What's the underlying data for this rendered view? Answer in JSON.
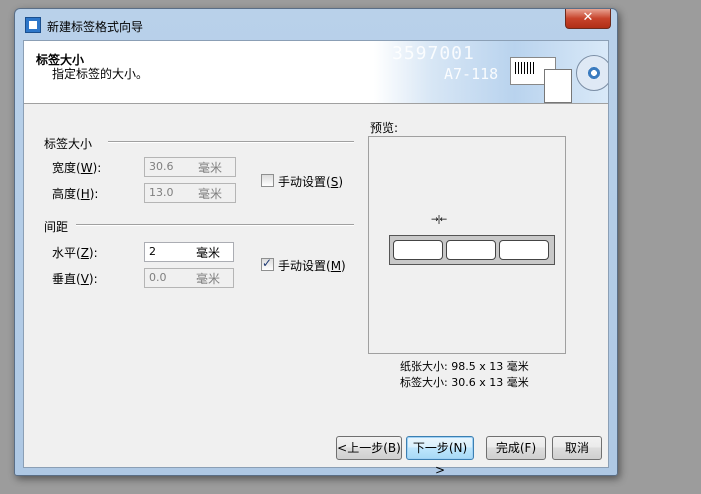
{
  "window": {
    "title": "新建标签格式向导",
    "close_glyph": "✕"
  },
  "header": {
    "title": "标签大小",
    "subtitle": "指定标签的大小。",
    "art_digits": "3597001",
    "art_code": "A7-118"
  },
  "label_size_group": {
    "title": "标签大小",
    "width": {
      "label": "宽度(",
      "key": "W",
      "suffix": "):",
      "value": "30.6",
      "unit": "毫米"
    },
    "height": {
      "label": "高度(",
      "key": "H",
      "suffix": "):",
      "value": "13.0",
      "unit": "毫米"
    },
    "manual": {
      "label": "手动设置(",
      "key": "S",
      "suffix": ")",
      "checked": false
    }
  },
  "spacing_group": {
    "title": "间距",
    "horizontal": {
      "label": "水平(",
      "key": "Z",
      "suffix": "):",
      "value": "2",
      "unit": "毫米"
    },
    "vertical": {
      "label": "垂直(",
      "key": "V",
      "suffix": "):",
      "value": "0.0",
      "unit": "毫米"
    },
    "manual": {
      "label": "手动设置(",
      "key": "M",
      "suffix": ")",
      "checked": true
    }
  },
  "preview": {
    "title": "预览:",
    "paper_size": "纸张大小:  98.5 x 13   毫米",
    "label_size": "标签大小:  30.6 x 13   毫米",
    "label_count": 3
  },
  "buttons": {
    "back": "<上一步(B)",
    "next": "下一步(N) >",
    "finish": "完成(F)",
    "cancel": "取消"
  }
}
